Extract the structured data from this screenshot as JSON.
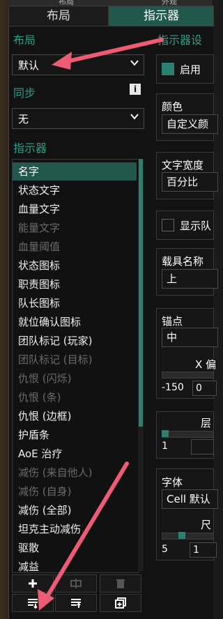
{
  "top_tabs": [
    {
      "label": "布局",
      "active": false
    },
    {
      "label": "指示器",
      "active": true
    }
  ],
  "topbar": {
    "left_label": "布局",
    "right_label": "外观"
  },
  "layout_section": {
    "title": "布局",
    "dropdown_value": "默认"
  },
  "sync_section": {
    "title": "同步",
    "dropdown_value": "无",
    "info_icon": "info-icon"
  },
  "indicator_section": {
    "title": "指示器",
    "items": [
      {
        "label": "名字",
        "state": "selected"
      },
      {
        "label": "状态文字",
        "state": "enabled"
      },
      {
        "label": "血量文字",
        "state": "enabled"
      },
      {
        "label": "能量文字",
        "state": "disabled"
      },
      {
        "label": "血量阈值",
        "state": "disabled"
      },
      {
        "label": "状态图标",
        "state": "enabled"
      },
      {
        "label": "职责图标",
        "state": "enabled"
      },
      {
        "label": "队长图标",
        "state": "enabled"
      },
      {
        "label": "就位确认图标",
        "state": "enabled"
      },
      {
        "label": "团队标记 (玩家)",
        "state": "enabled"
      },
      {
        "label": "团队标记 (目标)",
        "state": "disabled"
      },
      {
        "label": "仇恨 (闪烁)",
        "state": "disabled"
      },
      {
        "label": "仇恨 (条)",
        "state": "disabled"
      },
      {
        "label": "仇恨 (边框)",
        "state": "enabled"
      },
      {
        "label": "护盾条",
        "state": "enabled"
      },
      {
        "label": "AoE 治疗",
        "state": "enabled"
      },
      {
        "label": "减伤 (来自他人)",
        "state": "disabled"
      },
      {
        "label": "减伤 (自身)",
        "state": "disabled"
      },
      {
        "label": "减伤 (全部)",
        "state": "enabled"
      },
      {
        "label": "坦克主动减伤",
        "state": "enabled"
      },
      {
        "label": "驱散",
        "state": "enabled"
      },
      {
        "label": "减益",
        "state": "enabled"
      }
    ]
  },
  "settings_section": {
    "title": "指示器设",
    "enable_label": "启用",
    "color_label": "颜色",
    "color_value": "自定义颜",
    "text_width_label": "文字宽度",
    "text_width_value": "百分比",
    "show_label": "显示队",
    "vehicle_label": "载具名称",
    "vehicle_value": "上",
    "anchor_label": "锚点",
    "anchor_value": "中",
    "x_label": "X 偏",
    "x_min": "-150",
    "x_value": "0",
    "layer_label": "层",
    "layer_min": "1",
    "font_label": "字体",
    "font_value": "Cell 默认",
    "size_label": "尺",
    "size_min": "5",
    "size_value": "1"
  },
  "bottom_buttons": [
    {
      "icon": "add-icon"
    },
    {
      "icon": "rename-icon"
    },
    {
      "icon": "delete-icon"
    },
    {
      "icon": "import-icon"
    },
    {
      "icon": "export-icon"
    },
    {
      "icon": "copy-icon"
    }
  ],
  "accent_color": "#22574e",
  "arrow_color": "#ef5b73"
}
